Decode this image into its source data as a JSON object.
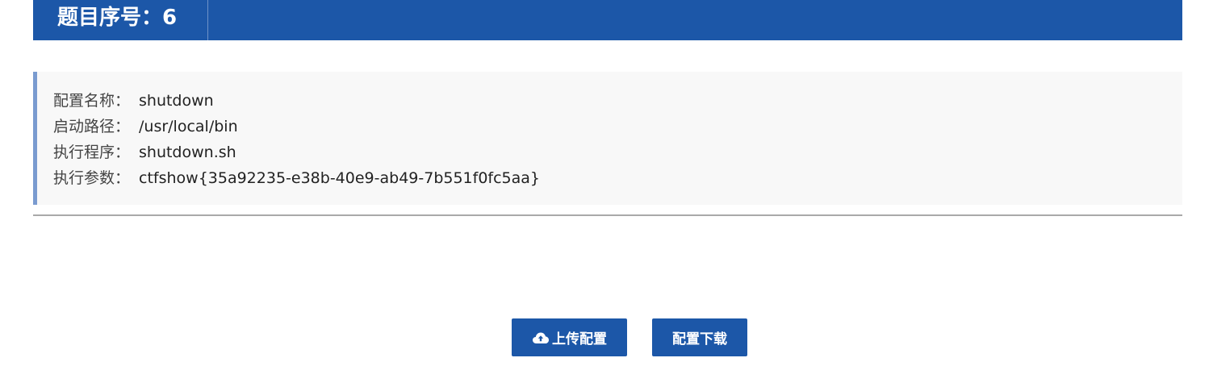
{
  "header": {
    "title": "题目序号：6"
  },
  "config": {
    "rows": [
      {
        "label": "配置名称：",
        "value": "shutdown"
      },
      {
        "label": "启动路径：",
        "value": "/usr/local/bin"
      },
      {
        "label": "执行程序：",
        "value": "shutdown.sh"
      },
      {
        "label": "执行参数：",
        "value": "ctfshow{35a92235-e38b-40e9-ab49-7b551f0fc5aa}"
      }
    ]
  },
  "actions": {
    "upload_label": "上传配置",
    "download_label": "配置下载",
    "upload_icon": "cloud-upload-icon"
  },
  "colors": {
    "primary": "#1c57a8",
    "panel_bg": "#f8f8f8",
    "panel_border": "#7a9bd0"
  }
}
